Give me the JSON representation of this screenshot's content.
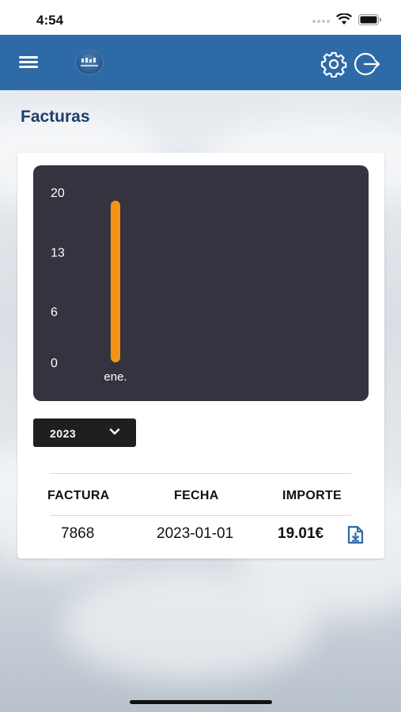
{
  "status_bar": {
    "time": "4:54"
  },
  "header": {
    "background": "#2e6aa6",
    "menu_icon": "hamburger-icon",
    "logo_icon": "app-logo",
    "settings_icon": "gear-icon",
    "logout_icon": "logout-icon"
  },
  "page": {
    "title": "Facturas"
  },
  "chart_data": {
    "type": "bar",
    "categories": [
      "ene."
    ],
    "values": [
      19.01
    ],
    "yticks": [
      0,
      6,
      13,
      20
    ],
    "ylim": [
      0,
      20
    ],
    "bar_color": "#f39419",
    "background": "#34333f",
    "grid": false
  },
  "year_filter": {
    "selected": "2023"
  },
  "table": {
    "columns": [
      "FACTURA",
      "FECHA",
      "IMPORTE"
    ],
    "rows": [
      {
        "factura": "7868",
        "fecha": "2023-01-01",
        "importe": "19.01€",
        "action_icon": "download-file-icon"
      }
    ]
  }
}
